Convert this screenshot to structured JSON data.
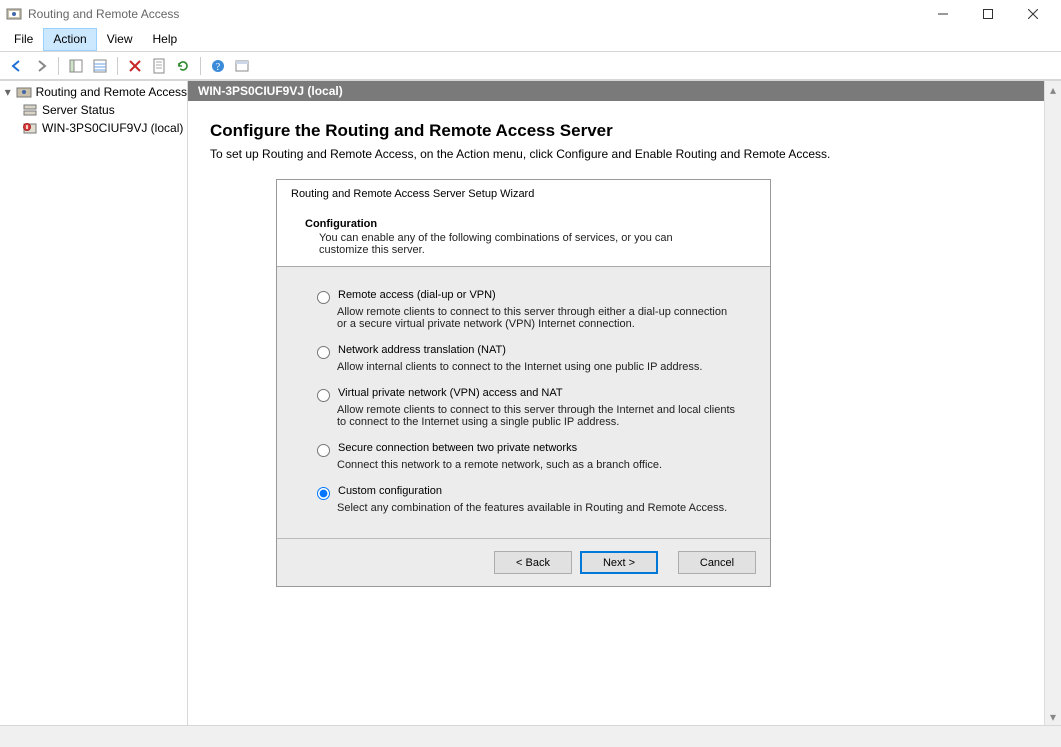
{
  "window": {
    "title": "Routing and Remote Access"
  },
  "menubar": {
    "file": "File",
    "action": "Action",
    "view": "View",
    "help": "Help"
  },
  "tree": {
    "root": "Routing and Remote Access",
    "server_status": "Server Status",
    "local_server": "WIN-3PS0CIUF9VJ (local)"
  },
  "content": {
    "header": "WIN-3PS0CIUF9VJ (local)",
    "title": "Configure the Routing and Remote Access Server",
    "subtitle": "To set up Routing and Remote Access, on the Action menu, click Configure and Enable Routing and Remote Access."
  },
  "wizard": {
    "title": "Routing and Remote Access Server Setup Wizard",
    "section_title": "Configuration",
    "section_desc": "You can enable any of the following combinations of services, or you can customize this server.",
    "options": [
      {
        "label": "Remote access (dial-up or VPN)",
        "desc": "Allow remote clients to connect to this server through either a dial-up connection or a secure virtual private network (VPN) Internet connection."
      },
      {
        "label": "Network address translation (NAT)",
        "desc": "Allow internal clients to connect to the Internet using one public IP address."
      },
      {
        "label": "Virtual private network (VPN) access and NAT",
        "desc": "Allow remote clients to connect to this server through the Internet and local clients to connect to the Internet using a single public IP address."
      },
      {
        "label": "Secure connection between two private networks",
        "desc": "Connect this network to a remote network, such as a branch office."
      },
      {
        "label": "Custom configuration",
        "desc": "Select any combination of the features available in Routing and Remote Access."
      }
    ],
    "selected_index": 4,
    "buttons": {
      "back": "< Back",
      "next": "Next >",
      "cancel": "Cancel"
    }
  }
}
